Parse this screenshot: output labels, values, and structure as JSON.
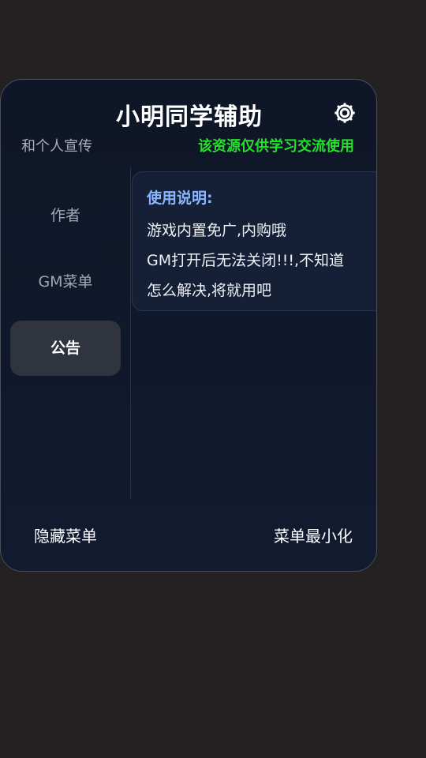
{
  "header": {
    "title": "小明同学辅助",
    "settings_icon": "gear-icon"
  },
  "marquee": {
    "left_text": "和个人宣传",
    "right_text": "该资源仅供学习交流使用",
    "right_color": "#25e02a"
  },
  "sidebar": {
    "items": [
      {
        "label": "作者",
        "active": false
      },
      {
        "label": "GM菜单",
        "active": false
      },
      {
        "label": "公告",
        "active": true
      }
    ]
  },
  "notice": {
    "heading": "使用说明:",
    "lines": [
      "游戏内置免广,内购哦",
      "GM打开后无法关闭!!!,不知道",
      "怎么解决,将就用吧"
    ]
  },
  "footer": {
    "hide_label": "隐藏菜单",
    "minimize_label": "菜单最小化"
  }
}
